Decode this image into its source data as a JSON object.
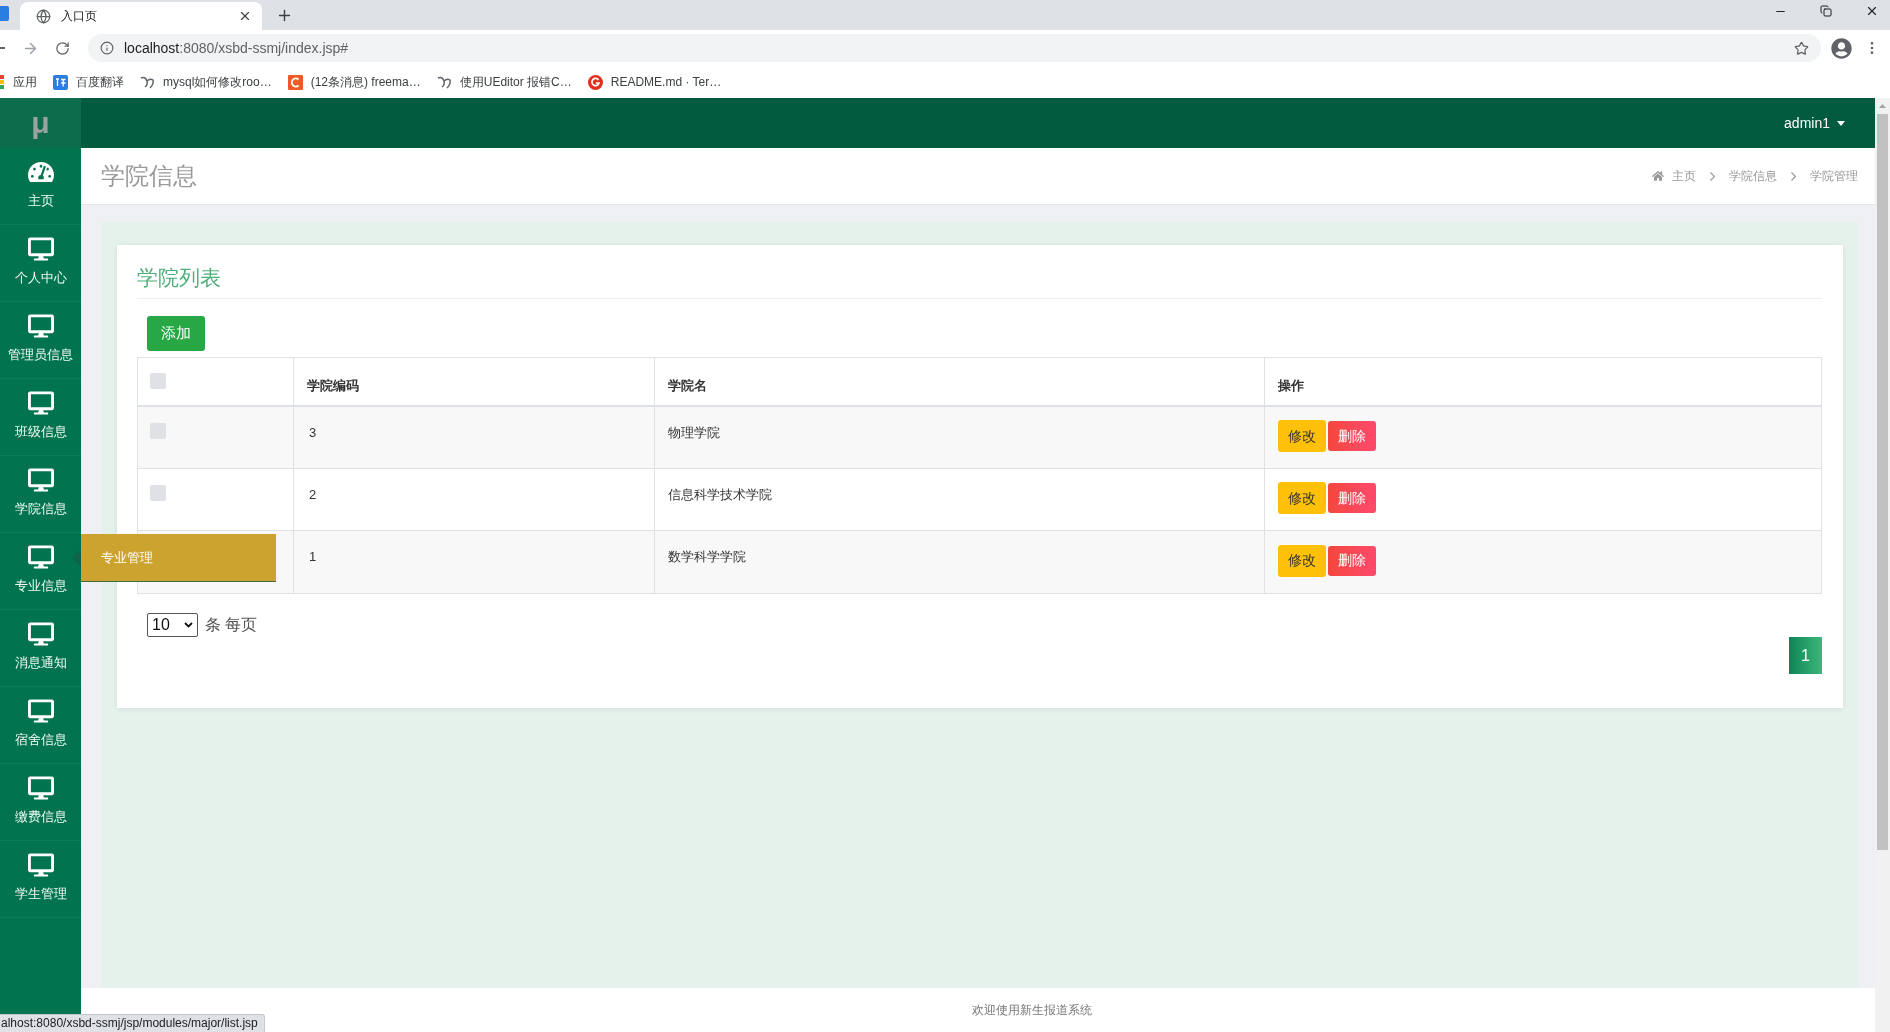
{
  "browser": {
    "tabs": [
      {
        "title": "入口页",
        "selected": true
      }
    ],
    "address": {
      "host": "localhost",
      "rest": ":8080/xsbd-ssmj/index.jsp#"
    },
    "bookmarks": [
      {
        "label": "应用",
        "kind": "apps"
      },
      {
        "label": "百度翻译",
        "kind": "translate"
      },
      {
        "label": "mysql如何修改roo…",
        "kind": "swirl"
      },
      {
        "label": "(12条消息) freema…",
        "kind": "square"
      },
      {
        "label": "使用UEditor 报错C…",
        "kind": "swirl"
      },
      {
        "label": "README.md · Ter…",
        "kind": "circle"
      }
    ],
    "status_text": "alhost:8080/xsbd-ssmj/jsp/modules/major/list.jsp"
  },
  "sidebar": {
    "logo": "μ",
    "items": [
      {
        "label": "主页",
        "kind": "dashboard",
        "expanded": false
      },
      {
        "label": "个人中心",
        "kind": "monitor",
        "expanded": false
      },
      {
        "label": "管理员信息",
        "kind": "monitor",
        "expanded": false
      },
      {
        "label": "班级信息",
        "kind": "monitor",
        "expanded": false
      },
      {
        "label": "学院信息",
        "kind": "monitor",
        "expanded": false
      },
      {
        "label": "专业信息",
        "kind": "monitor",
        "expanded": true,
        "submenu": [
          {
            "label": "专业管理"
          }
        ]
      },
      {
        "label": "消息通知",
        "kind": "monitor",
        "expanded": false
      },
      {
        "label": "宿舍信息",
        "kind": "monitor",
        "expanded": false
      },
      {
        "label": "缴费信息",
        "kind": "monitor",
        "expanded": false
      },
      {
        "label": "学生管理",
        "kind": "monitor",
        "expanded": false
      }
    ]
  },
  "header": {
    "user": "admin1"
  },
  "page": {
    "title": "学院信息",
    "breadcrumb": [
      {
        "label": "主页",
        "kind": "home"
      },
      {
        "label": "学院信息",
        "kind": "link"
      },
      {
        "label": "学院管理",
        "kind": "current"
      }
    ]
  },
  "card": {
    "title": "学院列表",
    "add_button": "添加",
    "table": {
      "header_checked": false,
      "columns": [
        "学院编码",
        "学院名",
        "操作"
      ],
      "rows": [
        {
          "checked": false,
          "code": "3",
          "name": "物理学院",
          "actions": [
            {
              "label": "修改",
              "kind": "edit"
            },
            {
              "label": "删除",
              "kind": "delete"
            }
          ]
        },
        {
          "checked": false,
          "code": "2",
          "name": "信息科学技术学院",
          "actions": [
            {
              "label": "修改",
              "kind": "edit"
            },
            {
              "label": "删除",
              "kind": "delete"
            }
          ]
        },
        {
          "code": "1",
          "name": "数学科学学院",
          "actions": [
            {
              "label": "修改",
              "kind": "edit"
            },
            {
              "label": "删除",
              "kind": "delete"
            }
          ]
        }
      ]
    },
    "page_size": "10",
    "page_size_suffix": "条 每页",
    "pages": [
      {
        "label": "1",
        "selected": true
      }
    ]
  },
  "footer": {
    "text": "欢迎使用新生报道系统"
  }
}
